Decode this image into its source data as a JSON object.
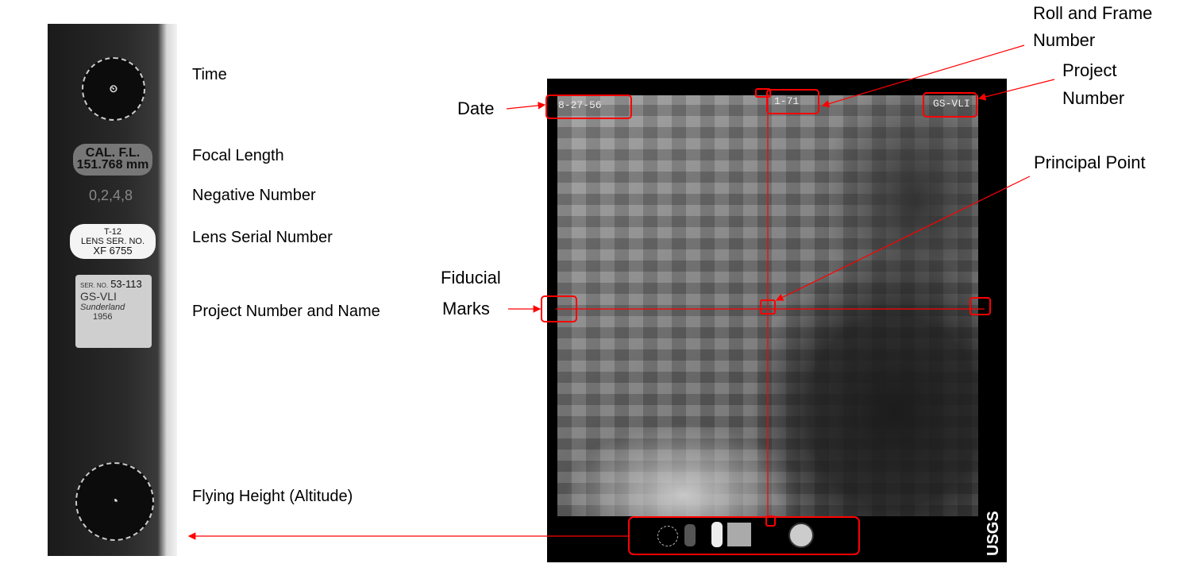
{
  "labels": {
    "time": "Time",
    "focal_length": "Focal Length",
    "negative_number": "Negative Number",
    "lens_serial_number": "Lens Serial Number",
    "project_number_and_name": "Project Number and Name",
    "flying_height": "Flying Height (Altitude)",
    "date": "Date",
    "roll_frame_1": "Roll and Frame",
    "roll_frame_2": "Number",
    "project_number_1": "Project",
    "project_number_2": "Number",
    "principal_point": "Principal Point",
    "fiducial_1": "Fiducial",
    "fiducial_2": "Marks"
  },
  "strip": {
    "focal_plate_1": "CAL. F.L.",
    "focal_plate_2": "151.768 mm",
    "negative_counter": "0,2,4,8",
    "lens_1": "T-12",
    "lens_2": "LENS SER. NO.",
    "lens_3": "XF 6755",
    "ser_no_label": "SER. NO.",
    "ser_no": "53-113",
    "project_code": "GS-VLI",
    "project_name": "Sunderland",
    "project_year": "1956"
  },
  "photo": {
    "date": "8-27-56",
    "roll_frame": "1-71",
    "project": "GS-VLI",
    "logo": "USGS"
  },
  "colors": {
    "annotation": "#ff0000"
  }
}
